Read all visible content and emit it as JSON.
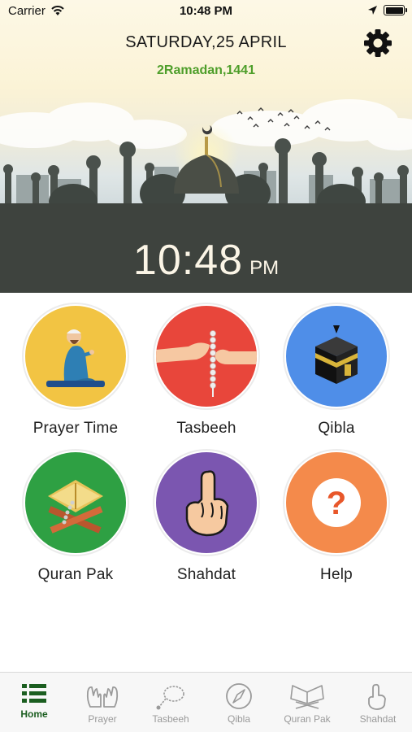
{
  "status_bar": {
    "carrier": "Carrier",
    "time": "10:48 PM"
  },
  "header": {
    "date": "SATURDAY,25 APRIL",
    "hijri_date": "2Ramadan,1441",
    "time": "10:48",
    "ampm": "PM"
  },
  "features": [
    {
      "label": "Prayer Time",
      "color": "#f2c443",
      "icon": "praying-man-icon"
    },
    {
      "label": "Tasbeeh",
      "color": "#e8463b",
      "icon": "tasbeeh-hands-icon"
    },
    {
      "label": "Qibla",
      "color": "#4f8ee8",
      "icon": "kaaba-icon"
    },
    {
      "label": "Quran Pak",
      "color": "#2ea043",
      "icon": "quran-stand-icon"
    },
    {
      "label": "Shahdat",
      "color": "#7b56b0",
      "icon": "index-finger-icon"
    },
    {
      "label": "Help",
      "color": "#f48a4b",
      "icon": "question-icon"
    }
  ],
  "tabs": [
    {
      "label": "Home",
      "icon": "list-icon",
      "active": true
    },
    {
      "label": "Prayer",
      "icon": "praying-hands-icon",
      "active": false
    },
    {
      "label": "Tasbeeh",
      "icon": "tasbeeh-beads-icon",
      "active": false
    },
    {
      "label": "Qibla",
      "icon": "compass-icon",
      "active": false
    },
    {
      "label": "Quran Pak",
      "icon": "quran-icon",
      "active": false
    },
    {
      "label": "Shahdat",
      "icon": "pointing-hand-icon",
      "active": false
    }
  ],
  "colors": {
    "active_tab": "#1b5e20",
    "hijri": "#4e9e2a",
    "time_band": "#3e433e"
  }
}
